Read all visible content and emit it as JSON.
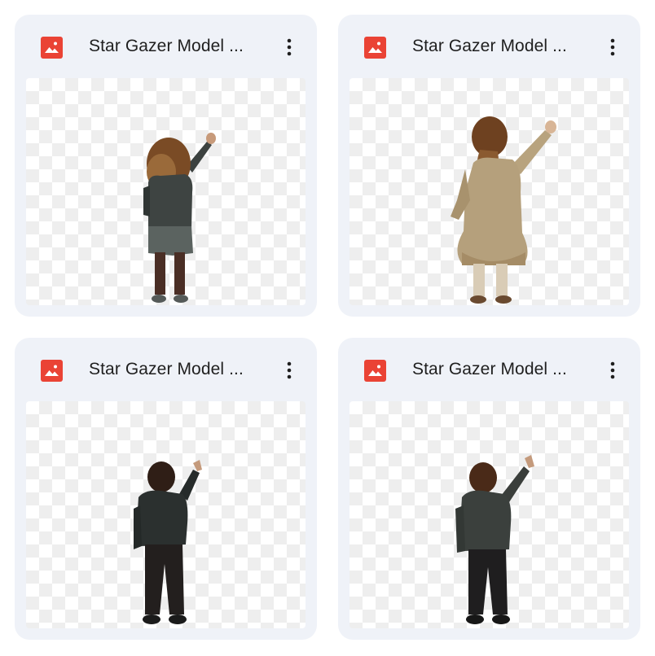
{
  "files": [
    {
      "name": "Star Gazer Model ...",
      "type_icon": "image-file-icon",
      "menu_icon": "more-vert-icon",
      "subject": "girl-in-grey-jacket"
    },
    {
      "name": "Star Gazer Model ...",
      "type_icon": "image-file-icon",
      "menu_icon": "more-vert-icon",
      "subject": "girl-in-gold-dress"
    },
    {
      "name": "Star Gazer Model ...",
      "type_icon": "image-file-icon",
      "menu_icon": "more-vert-icon",
      "subject": "boy-in-dark-hoodie"
    },
    {
      "name": "Star Gazer Model ...",
      "type_icon": "image-file-icon",
      "menu_icon": "more-vert-icon",
      "subject": "boy-in-dark-jacket"
    }
  ],
  "colors": {
    "card_bg": "#eff2f8",
    "image_icon": "#ea4335",
    "text": "#1f1f1f"
  }
}
